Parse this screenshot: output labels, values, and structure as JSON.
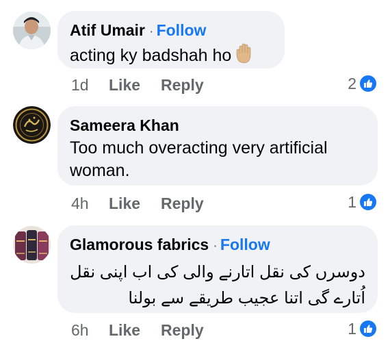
{
  "comments": [
    {
      "name": "Atif Umair",
      "separator": "·",
      "follow": "Follow",
      "text": "acting ky badshah ho",
      "emoji_icon": "raised-hand-icon",
      "time": "1d",
      "like": "Like",
      "reply": "Reply",
      "reaction_count": "2"
    },
    {
      "name": "Sameera Khan",
      "text": "Too much overacting very artificial woman.",
      "time": "4h",
      "like": "Like",
      "reply": "Reply",
      "reaction_count": "1"
    },
    {
      "name": "Glamorous fabrics",
      "separator": "·",
      "follow": "Follow",
      "text": "دوسرں کی نقل اتارنے والی کی اب اپنی نقل اُتارے گی اتنا عجیب طریقے سے بولنا",
      "time": "6h",
      "like": "Like",
      "reply": "Reply",
      "reaction_count": "1"
    }
  ],
  "colors": {
    "link_blue": "#1877f2",
    "bubble_bg": "#f0f2f5",
    "meta_gray": "#65676b"
  }
}
